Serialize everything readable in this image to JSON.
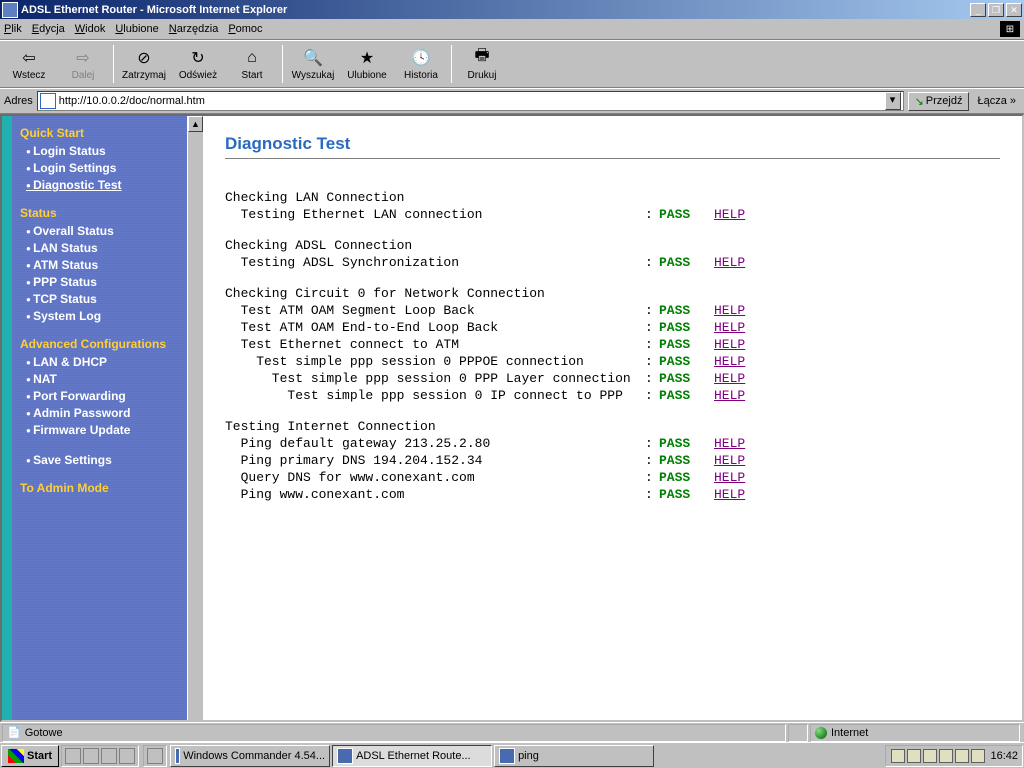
{
  "window": {
    "title": "ADSL Ethernet Router - Microsoft Internet Explorer"
  },
  "menubar": [
    "Plik",
    "Edycja",
    "Widok",
    "Ulubione",
    "Narzędzia",
    "Pomoc"
  ],
  "toolbar": {
    "back": "Wstecz",
    "forward": "Dalej",
    "stop": "Zatrzymaj",
    "refresh": "Odśwież",
    "home": "Start",
    "search": "Wyszukaj",
    "favorites": "Ulubione",
    "history": "Historia",
    "print": "Drukuj"
  },
  "addressbar": {
    "label": "Adres",
    "url": "http://10.0.0.2/doc/normal.htm",
    "go": "Przejdź",
    "links": "Łącza »"
  },
  "sidebar": {
    "sections": [
      {
        "title": "Quick Start",
        "items": [
          "Login Status",
          "Login Settings",
          "Diagnostic Test"
        ],
        "current": 2
      },
      {
        "title": "Status",
        "items": [
          "Overall Status",
          "LAN Status",
          "ATM Status",
          "PPP Status",
          "TCP Status",
          "System Log"
        ]
      },
      {
        "title": "Advanced Configurations",
        "items": [
          "LAN & DHCP",
          "NAT",
          "Port Forwarding",
          "Admin Password",
          "Firmware Update",
          "",
          "Save Settings"
        ]
      }
    ],
    "admin": "To Admin Mode"
  },
  "page": {
    "title": "Diagnostic Test",
    "help": "HELP",
    "groups": [
      {
        "header": "Checking LAN Connection",
        "rows": [
          {
            "indent": 1,
            "label": "Testing Ethernet LAN connection",
            "result": "PASS"
          }
        ]
      },
      {
        "header": "Checking ADSL Connection",
        "rows": [
          {
            "indent": 1,
            "label": "Testing ADSL Synchronization",
            "result": "PASS"
          }
        ]
      },
      {
        "header": "Checking Circuit 0 for Network Connection",
        "rows": [
          {
            "indent": 1,
            "label": "Test ATM OAM Segment Loop Back",
            "result": "PASS"
          },
          {
            "indent": 1,
            "label": "Test ATM OAM End-to-End Loop Back",
            "result": "PASS"
          },
          {
            "indent": 1,
            "label": "Test Ethernet connect to ATM",
            "result": "PASS"
          },
          {
            "indent": 2,
            "label": "Test simple ppp session 0 PPPOE connection",
            "result": "PASS"
          },
          {
            "indent": 3,
            "label": "Test simple ppp session 0 PPP Layer connection",
            "result": "PASS"
          },
          {
            "indent": 4,
            "label": "Test simple ppp session 0 IP connect to PPP",
            "result": "PASS"
          }
        ]
      },
      {
        "header": "Testing Internet Connection",
        "rows": [
          {
            "indent": 1,
            "label": "Ping default gateway 213.25.2.80",
            "result": "PASS"
          },
          {
            "indent": 1,
            "label": "Ping primary DNS 194.204.152.34",
            "result": "PASS"
          },
          {
            "indent": 1,
            "label": "Query DNS for www.conexant.com",
            "result": "PASS"
          },
          {
            "indent": 1,
            "label": "Ping www.conexant.com",
            "result": "PASS"
          }
        ]
      }
    ]
  },
  "statusbar": {
    "status": "Gotowe",
    "zone": "Internet"
  },
  "taskbar": {
    "start": "Start",
    "tasks": [
      {
        "label": "Windows Commander 4.54...",
        "active": false
      },
      {
        "label": "ADSL Ethernet Route...",
        "active": true
      },
      {
        "label": "ping",
        "active": false
      }
    ],
    "clock": "16:42"
  }
}
